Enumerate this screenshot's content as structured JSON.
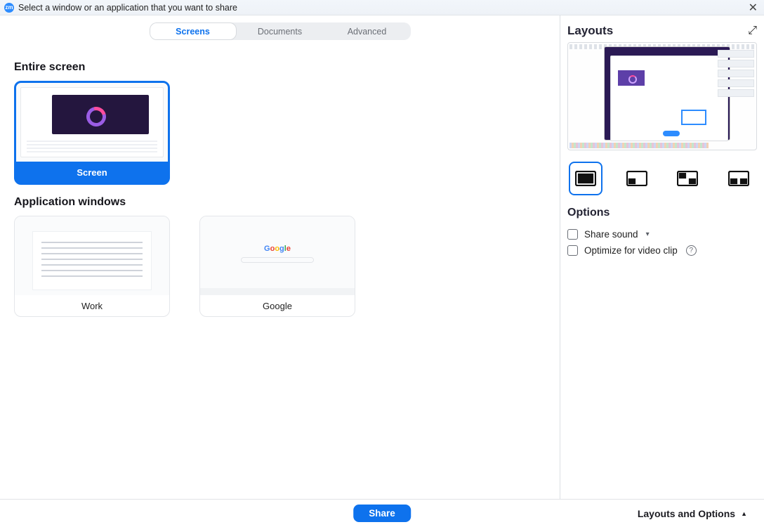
{
  "titlebar": {
    "logo_text": "zm",
    "title": "Select a window or an application that you want to share"
  },
  "tabs": {
    "screens": "Screens",
    "documents": "Documents",
    "advanced": "Advanced"
  },
  "sections": {
    "entire_screen": "Entire screen",
    "application_windows": "Application windows"
  },
  "cards": {
    "screen_label": "Screen",
    "app1_label": "Work",
    "app2_label": "Google"
  },
  "right": {
    "layouts_head": "Layouts",
    "options_head": "Options",
    "share_sound": "Share sound",
    "optimize_video": "Optimize for video clip"
  },
  "footer": {
    "share": "Share",
    "layouts_toggle": "Layouts and Options"
  }
}
